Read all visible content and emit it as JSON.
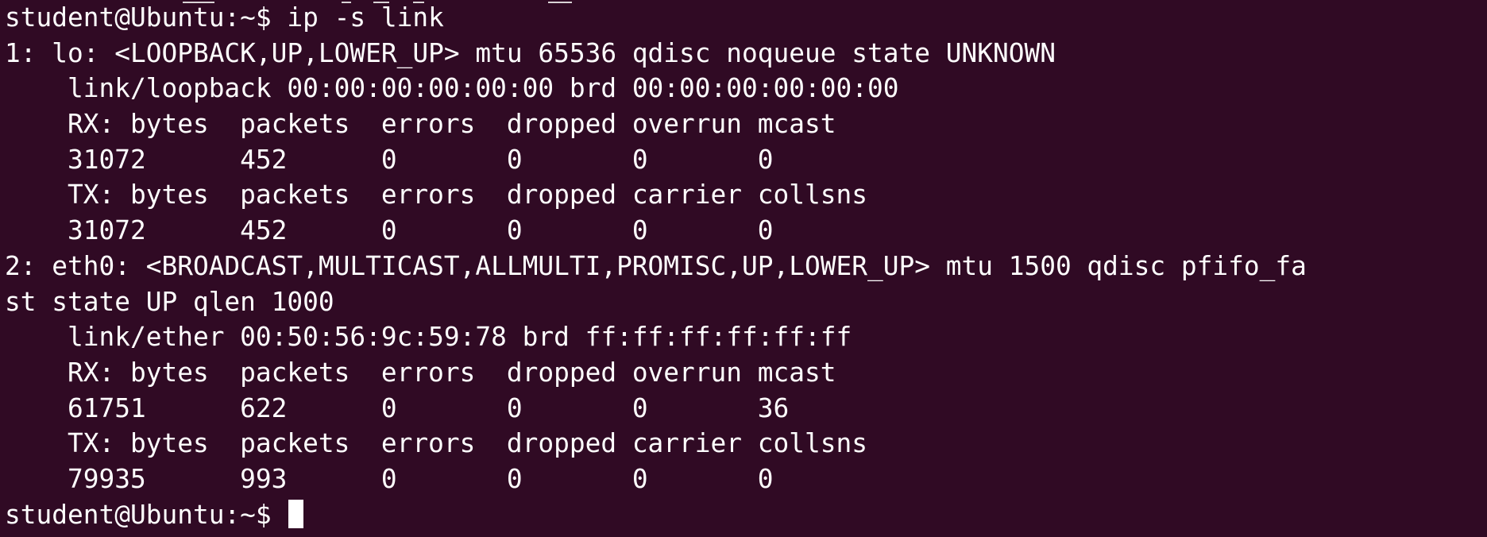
{
  "terminal": {
    "background": "#300a24",
    "foreground": "#ffffff",
    "lines": [
      "student@Ubuntu:~$ ip -s link",
      "1: lo: <LOOPBACK,UP,LOWER_UP> mtu 65536 qdisc noqueue state UNKNOWN",
      "    link/loopback 00:00:00:00:00:00 brd 00:00:00:00:00:00",
      "    RX: bytes  packets  errors  dropped overrun mcast",
      "    31072      452      0       0       0       0",
      "    TX: bytes  packets  errors  dropped carrier collsns",
      "    31072      452      0       0       0       0",
      "2: eth0: <BROADCAST,MULTICAST,ALLMULTI,PROMISC,UP,LOWER_UP> mtu 1500 qdisc pfifo_fa",
      "st state UP qlen 1000",
      "    link/ether 00:50:56:9c:59:78 brd ff:ff:ff:ff:ff:ff",
      "    RX: bytes  packets  errors  dropped overrun mcast",
      "    61751      622      0       0       0       36",
      "    TX: bytes  packets  errors  dropped carrier collsns",
      "    79935      993      0       0       0       0"
    ],
    "prompt": "student@Ubuntu:~$ "
  }
}
